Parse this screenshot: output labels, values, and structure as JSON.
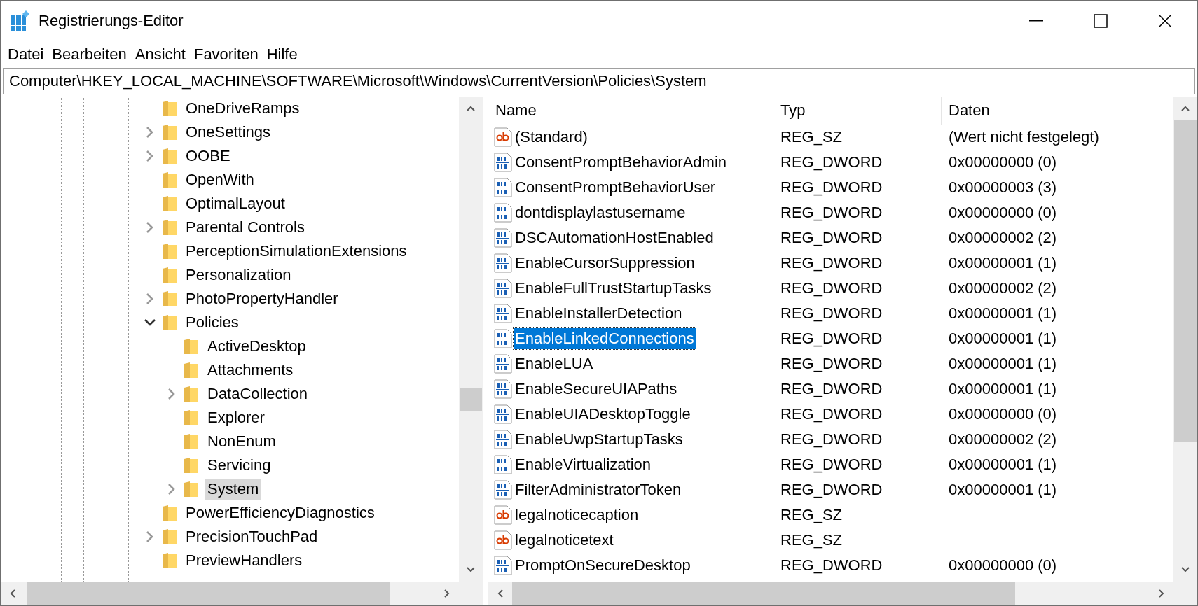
{
  "window": {
    "title": "Registrierungs-Editor"
  },
  "menu": [
    "Datei",
    "Bearbeiten",
    "Ansicht",
    "Favoriten",
    "Hilfe"
  ],
  "address": "Computer\\HKEY_LOCAL_MACHINE\\SOFTWARE\\Microsoft\\Windows\\CurrentVersion\\Policies\\System",
  "tree": [
    {
      "label": "OneDriveRamps",
      "expandable": false,
      "selected": false
    },
    {
      "label": "OneSettings",
      "expandable": true,
      "expanded": false,
      "selected": false
    },
    {
      "label": "OOBE",
      "expandable": true,
      "expanded": false,
      "selected": false
    },
    {
      "label": "OpenWith",
      "expandable": false,
      "selected": false
    },
    {
      "label": "OptimalLayout",
      "expandable": false,
      "selected": false
    },
    {
      "label": "Parental Controls",
      "expandable": true,
      "expanded": false,
      "selected": false
    },
    {
      "label": "PerceptionSimulationExtensions",
      "expandable": false,
      "selected": false
    },
    {
      "label": "Personalization",
      "expandable": false,
      "selected": false
    },
    {
      "label": "PhotoPropertyHandler",
      "expandable": true,
      "expanded": false,
      "selected": false
    },
    {
      "label": "Policies",
      "expandable": true,
      "expanded": true,
      "selected": false,
      "children": [
        {
          "label": "ActiveDesktop",
          "expandable": false,
          "selected": false
        },
        {
          "label": "Attachments",
          "expandable": false,
          "selected": false
        },
        {
          "label": "DataCollection",
          "expandable": true,
          "expanded": false,
          "selected": false
        },
        {
          "label": "Explorer",
          "expandable": false,
          "selected": false
        },
        {
          "label": "NonEnum",
          "expandable": false,
          "selected": false
        },
        {
          "label": "Servicing",
          "expandable": false,
          "selected": false
        },
        {
          "label": "System",
          "expandable": true,
          "expanded": false,
          "selected": true
        }
      ]
    },
    {
      "label": "PowerEfficiencyDiagnostics",
      "expandable": false,
      "selected": false
    },
    {
      "label": "PrecisionTouchPad",
      "expandable": true,
      "expanded": false,
      "selected": false
    },
    {
      "label": "PreviewHandlers",
      "expandable": false,
      "selected": false
    }
  ],
  "table": {
    "columns": [
      "Name",
      "Typ",
      "Daten"
    ],
    "rows": [
      {
        "kind": "string",
        "name": "(Standard)",
        "type": "REG_SZ",
        "data": "(Wert nicht festgelegt)",
        "selected": false
      },
      {
        "kind": "dword",
        "name": "ConsentPromptBehaviorAdmin",
        "type": "REG_DWORD",
        "data": "0x00000000 (0)",
        "selected": false
      },
      {
        "kind": "dword",
        "name": "ConsentPromptBehaviorUser",
        "type": "REG_DWORD",
        "data": "0x00000003 (3)",
        "selected": false
      },
      {
        "kind": "dword",
        "name": "dontdisplaylastusername",
        "type": "REG_DWORD",
        "data": "0x00000000 (0)",
        "selected": false
      },
      {
        "kind": "dword",
        "name": "DSCAutomationHostEnabled",
        "type": "REG_DWORD",
        "data": "0x00000002 (2)",
        "selected": false
      },
      {
        "kind": "dword",
        "name": "EnableCursorSuppression",
        "type": "REG_DWORD",
        "data": "0x00000001 (1)",
        "selected": false
      },
      {
        "kind": "dword",
        "name": "EnableFullTrustStartupTasks",
        "type": "REG_DWORD",
        "data": "0x00000002 (2)",
        "selected": false
      },
      {
        "kind": "dword",
        "name": "EnableInstallerDetection",
        "type": "REG_DWORD",
        "data": "0x00000001 (1)",
        "selected": false
      },
      {
        "kind": "dword",
        "name": "EnableLinkedConnections",
        "type": "REG_DWORD",
        "data": "0x00000001 (1)",
        "selected": true
      },
      {
        "kind": "dword",
        "name": "EnableLUA",
        "type": "REG_DWORD",
        "data": "0x00000001 (1)",
        "selected": false
      },
      {
        "kind": "dword",
        "name": "EnableSecureUIAPaths",
        "type": "REG_DWORD",
        "data": "0x00000001 (1)",
        "selected": false
      },
      {
        "kind": "dword",
        "name": "EnableUIADesktopToggle",
        "type": "REG_DWORD",
        "data": "0x00000000 (0)",
        "selected": false
      },
      {
        "kind": "dword",
        "name": "EnableUwpStartupTasks",
        "type": "REG_DWORD",
        "data": "0x00000002 (2)",
        "selected": false
      },
      {
        "kind": "dword",
        "name": "EnableVirtualization",
        "type": "REG_DWORD",
        "data": "0x00000001 (1)",
        "selected": false
      },
      {
        "kind": "dword",
        "name": "FilterAdministratorToken",
        "type": "REG_DWORD",
        "data": "0x00000001 (1)",
        "selected": false
      },
      {
        "kind": "string",
        "name": "legalnoticecaption",
        "type": "REG_SZ",
        "selected": false
      },
      {
        "kind": "string",
        "name": "legalnoticetext",
        "type": "REG_SZ",
        "selected": false
      },
      {
        "kind": "dword",
        "name": "PromptOnSecureDesktop",
        "type": "REG_DWORD",
        "data": "0x00000000 (0)",
        "selected": false
      }
    ]
  }
}
